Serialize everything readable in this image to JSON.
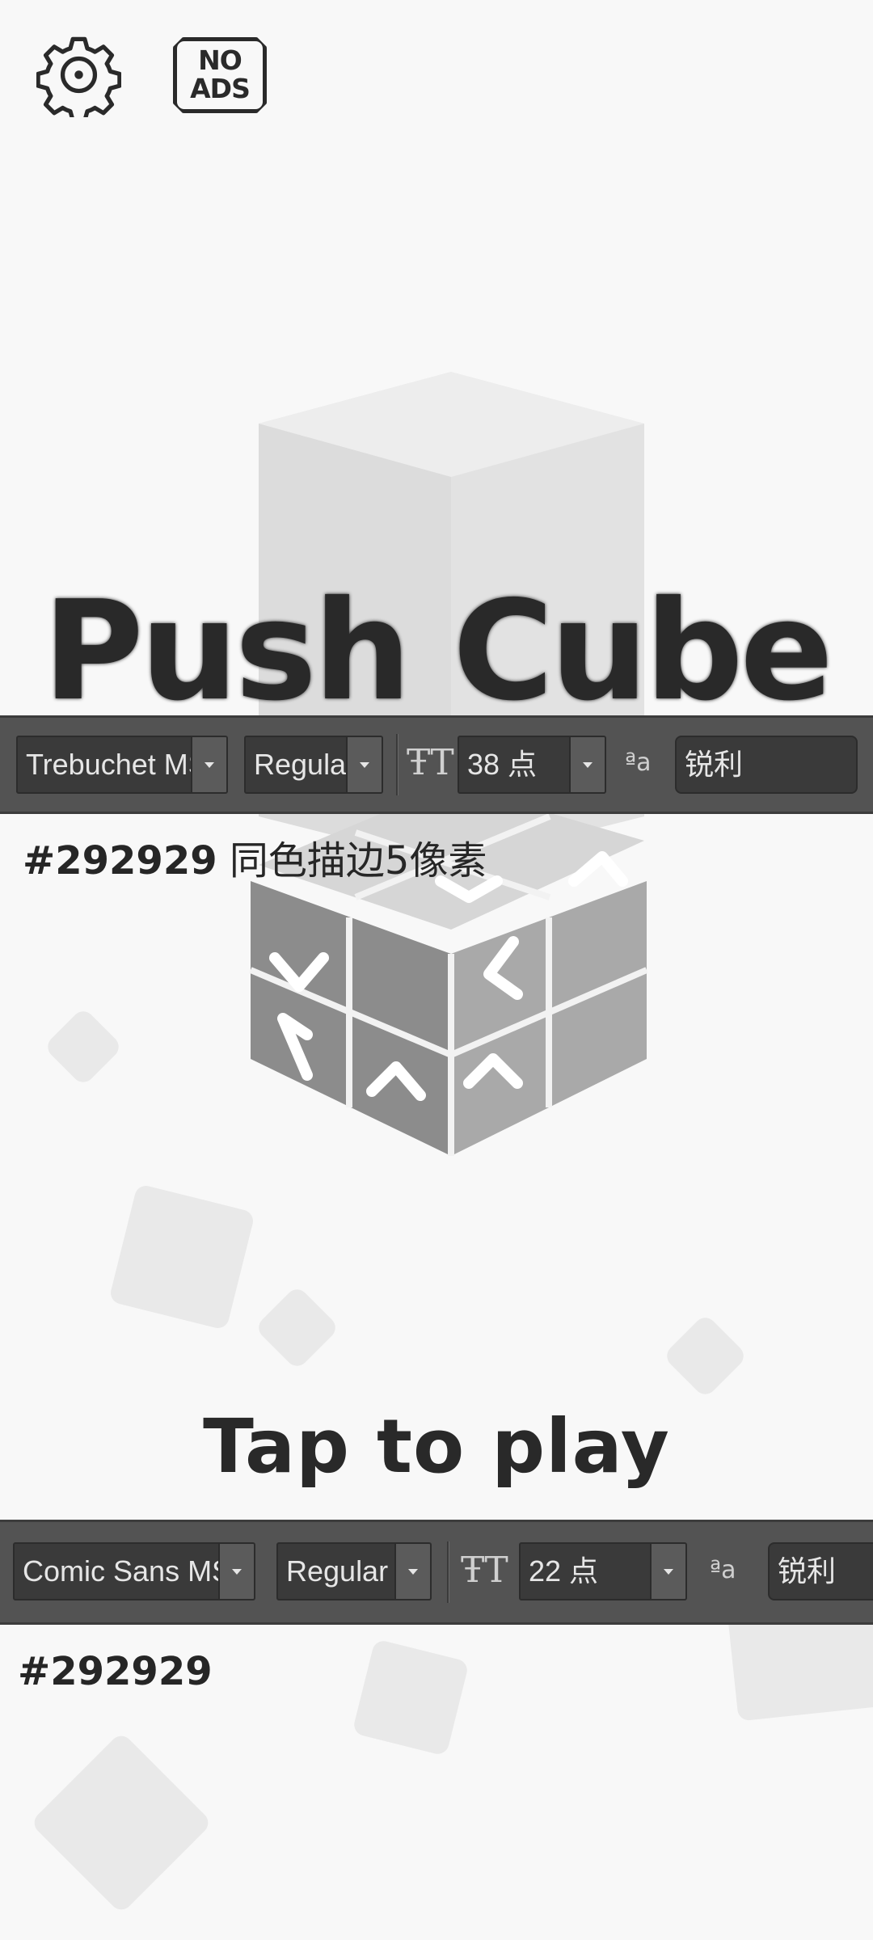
{
  "header": {
    "settings_icon": "gear-icon",
    "no_ads_line1": "NO",
    "no_ads_line2": "ADS"
  },
  "title": "Push Cube",
  "tap_prompt": "Tap to play",
  "toolbar_top": {
    "font_family": "Trebuchet MS",
    "font_style": "Regular",
    "font_size": "38 点",
    "antialias": "锐利"
  },
  "note_top": {
    "hex": "#292929",
    "text": "同色描边5像素"
  },
  "toolbar_bottom": {
    "font_family": "Comic Sans MS",
    "font_style": "Regular",
    "font_size": "22 点",
    "antialias": "锐利"
  },
  "note_bottom": {
    "hex": "#292929"
  },
  "colors": {
    "background": "#f8f8f8",
    "text": "#292929",
    "cube_dark": "#8a8a8a",
    "cube_light": "#cfcfcf",
    "toolbar": "#535353"
  }
}
